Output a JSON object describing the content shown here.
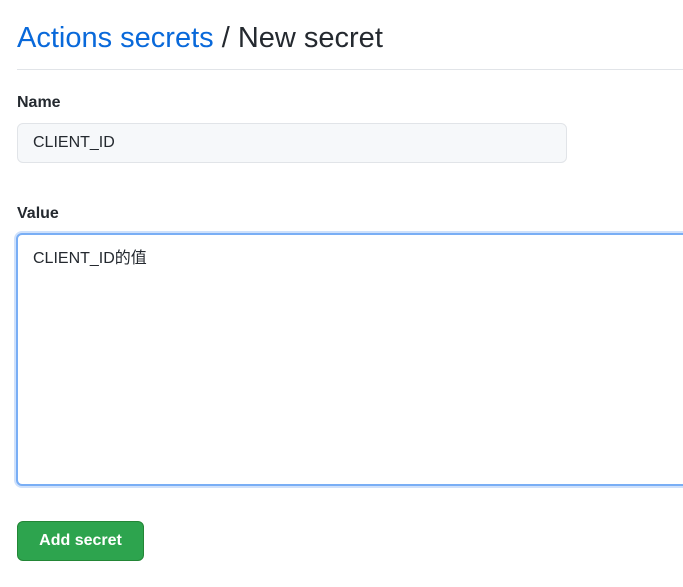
{
  "header": {
    "breadcrumb_link": "Actions secrets",
    "separator": "/",
    "current_page": "New secret"
  },
  "form": {
    "name_label": "Name",
    "name_value": "CLIENT_ID",
    "value_label": "Value",
    "value_text": "CLIENT_ID的值",
    "submit_label": "Add secret"
  },
  "colors": {
    "link": "#0969da",
    "button": "#2da44e",
    "focus_border": "#79aef5"
  }
}
